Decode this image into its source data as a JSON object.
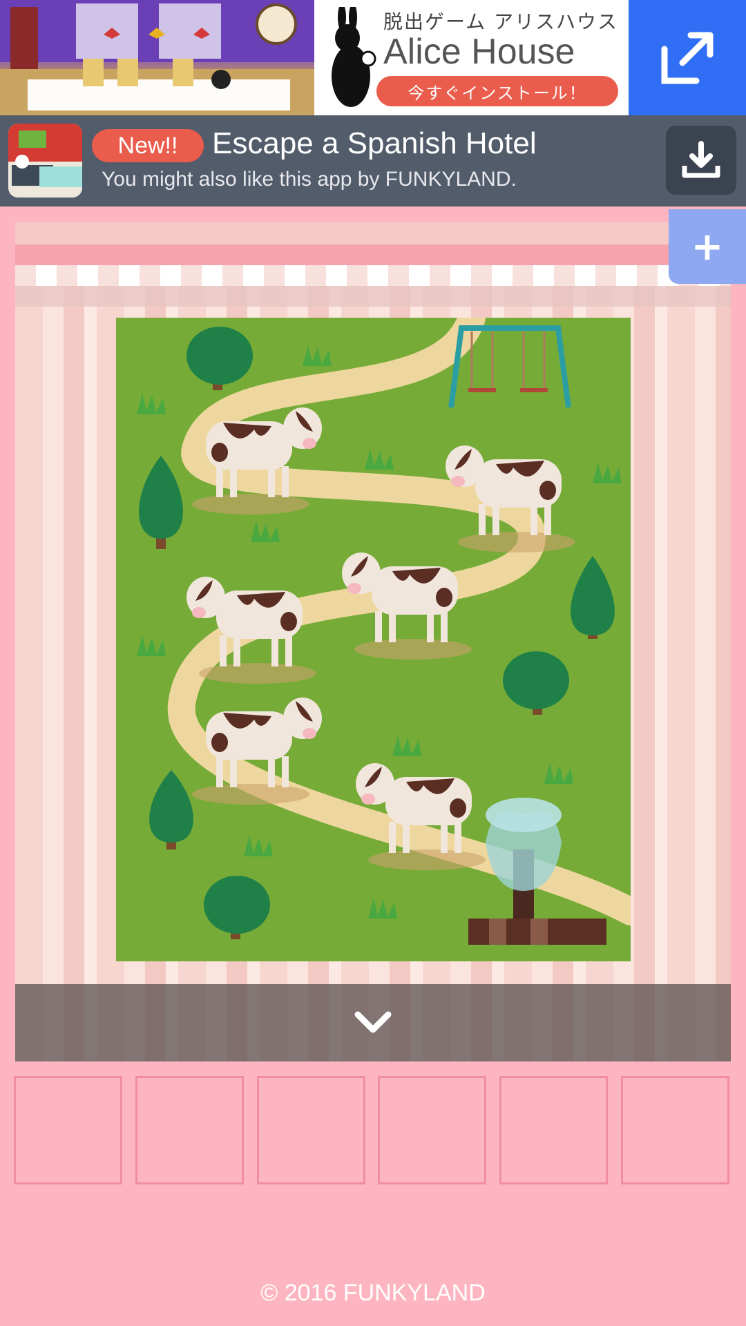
{
  "ad_top": {
    "jp_caption": "脱出ゲーム アリスハウス",
    "title": "Alice House",
    "install_label": "今すぐインストール！",
    "open_icon": "external-link-icon"
  },
  "banner": {
    "badge": "New!!",
    "title": "Escape a Spanish Hotel",
    "subtitle": "You might also like this app by FUNKYLAND.",
    "download_icon": "download-icon"
  },
  "controls": {
    "plus_label": "+",
    "down_icon": "chevron-down-icon"
  },
  "inventory": {
    "slots": [
      "",
      "",
      "",
      "",
      "",
      ""
    ]
  },
  "footer": {
    "copyright": "© 2016 FUNKYLAND"
  },
  "colors": {
    "background": "#fdb6c1",
    "accent_blue": "#2f6ef5",
    "badge_red": "#ea5c4c",
    "grass": "#76ab38"
  }
}
